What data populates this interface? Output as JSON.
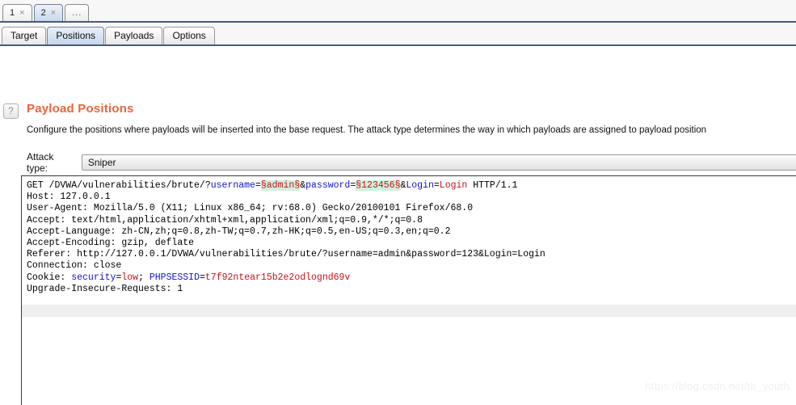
{
  "window_tabs": [
    {
      "label": "1",
      "close": "×",
      "selected": false
    },
    {
      "label": "2",
      "close": "×",
      "selected": true
    },
    {
      "label": "...",
      "close": "",
      "selected": false
    }
  ],
  "module_tabs": [
    {
      "label": "Target",
      "selected": false
    },
    {
      "label": "Positions",
      "selected": true
    },
    {
      "label": "Payloads",
      "selected": false
    },
    {
      "label": "Options",
      "selected": false
    }
  ],
  "help_icon": "?",
  "section": {
    "title": "Payload Positions",
    "description": "Configure the positions where payloads will be inserted into the base request. The attack type determines the way in which payloads are assigned to payload position"
  },
  "attack_type": {
    "label": "Attack type:",
    "value": "Sniper"
  },
  "request": {
    "lines": [
      {
        "id": "request-line",
        "tokens": [
          {
            "text": "GET /DVWA/vulnerabilities/brute/?",
            "style": "plain"
          },
          {
            "text": "username",
            "style": "name"
          },
          {
            "text": "=",
            "style": "plain"
          },
          {
            "text": "§",
            "style": "mark-hl"
          },
          {
            "text": "admin",
            "style": "val-hl"
          },
          {
            "text": "§",
            "style": "mark-hl"
          },
          {
            "text": "&",
            "style": "plain"
          },
          {
            "text": "password",
            "style": "name"
          },
          {
            "text": "=",
            "style": "plain"
          },
          {
            "text": "§",
            "style": "mark-hl"
          },
          {
            "text": "123456",
            "style": "val-hl"
          },
          {
            "text": "§",
            "style": "mark-hl"
          },
          {
            "text": "&",
            "style": "plain"
          },
          {
            "text": "Login",
            "style": "name"
          },
          {
            "text": "=",
            "style": "plain"
          },
          {
            "text": "Login",
            "style": "val"
          },
          {
            "text": " HTTP/1.1",
            "style": "plain"
          }
        ]
      },
      {
        "id": "header-host",
        "tokens": [
          {
            "text": "Host: 127.0.0.1",
            "style": "plain"
          }
        ]
      },
      {
        "id": "header-user-agent",
        "tokens": [
          {
            "text": "User-Agent: Mozilla/5.0 (X11; Linux x86_64; rv:68.0) Gecko/20100101 Firefox/68.0",
            "style": "plain"
          }
        ]
      },
      {
        "id": "header-accept",
        "tokens": [
          {
            "text": "Accept: text/html,application/xhtml+xml,application/xml;q=0.9,*/*;q=0.8",
            "style": "plain"
          }
        ]
      },
      {
        "id": "header-accept-language",
        "tokens": [
          {
            "text": "Accept-Language: zh-CN,zh;q=0.8,zh-TW;q=0.7,zh-HK;q=0.5,en-US;q=0.3,en;q=0.2",
            "style": "plain"
          }
        ]
      },
      {
        "id": "header-accept-encoding",
        "tokens": [
          {
            "text": "Accept-Encoding: gzip, deflate",
            "style": "plain"
          }
        ]
      },
      {
        "id": "header-referer",
        "tokens": [
          {
            "text": "Referer: http://127.0.0.1/DVWA/vulnerabilities/brute/?username=admin&password=123&Login=Login",
            "style": "plain"
          }
        ]
      },
      {
        "id": "header-connection",
        "tokens": [
          {
            "text": "Connection: close",
            "style": "plain"
          }
        ]
      },
      {
        "id": "header-cookie",
        "tokens": [
          {
            "text": "Cookie: ",
            "style": "plain"
          },
          {
            "text": "security",
            "style": "name"
          },
          {
            "text": "=",
            "style": "plain"
          },
          {
            "text": "low",
            "style": "val"
          },
          {
            "text": "; ",
            "style": "plain"
          },
          {
            "text": "PHPSESSID",
            "style": "name"
          },
          {
            "text": "=",
            "style": "plain"
          },
          {
            "text": "t7f92ntear15b2e2odlognd69v",
            "style": "val"
          }
        ]
      },
      {
        "id": "header-upgrade-insecure-requests",
        "tokens": [
          {
            "text": "Upgrade-Insecure-Requests: 1",
            "style": "plain"
          }
        ]
      }
    ]
  },
  "watermark": "https://blog.csdn.net/tb_youth",
  "colors": {
    "title": "#e8663c",
    "param_name": "#1414c8",
    "param_value": "#c0141e",
    "marker": "#d00000",
    "payload_highlight": "#d2f0dc",
    "tab_selected": "#c6d7ea",
    "tab_border": "#4a5a78"
  }
}
